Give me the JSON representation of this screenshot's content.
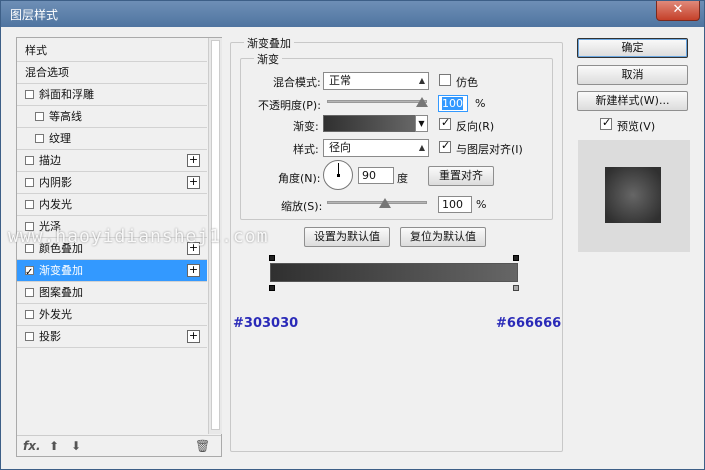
{
  "window": {
    "title": "图层样式",
    "close_glyph": "✕"
  },
  "left_panel": {
    "items": [
      {
        "label": "样式",
        "checkbox": false,
        "checked": false,
        "plus": false,
        "indent": 0,
        "selected": false
      },
      {
        "label": "混合选项",
        "checkbox": false,
        "checked": false,
        "plus": false,
        "indent": 0,
        "selected": false
      },
      {
        "label": "斜面和浮雕",
        "checkbox": true,
        "checked": false,
        "plus": false,
        "indent": 0,
        "selected": false
      },
      {
        "label": "等高线",
        "checkbox": true,
        "checked": false,
        "plus": false,
        "indent": 1,
        "selected": false
      },
      {
        "label": "纹理",
        "checkbox": true,
        "checked": false,
        "plus": false,
        "indent": 1,
        "selected": false
      },
      {
        "label": "描边",
        "checkbox": true,
        "checked": false,
        "plus": true,
        "indent": 0,
        "selected": false
      },
      {
        "label": "内阴影",
        "checkbox": true,
        "checked": false,
        "plus": true,
        "indent": 0,
        "selected": false
      },
      {
        "label": "内发光",
        "checkbox": true,
        "checked": false,
        "plus": false,
        "indent": 0,
        "selected": false
      },
      {
        "label": "光泽",
        "checkbox": true,
        "checked": false,
        "plus": false,
        "indent": 0,
        "selected": false
      },
      {
        "label": "颜色叠加",
        "checkbox": true,
        "checked": false,
        "plus": true,
        "indent": 0,
        "selected": false
      },
      {
        "label": "渐变叠加",
        "checkbox": true,
        "checked": true,
        "plus": true,
        "indent": 0,
        "selected": true
      },
      {
        "label": "图案叠加",
        "checkbox": true,
        "checked": false,
        "plus": false,
        "indent": 0,
        "selected": false
      },
      {
        "label": "外发光",
        "checkbox": true,
        "checked": false,
        "plus": false,
        "indent": 0,
        "selected": false
      },
      {
        "label": "投影",
        "checkbox": true,
        "checked": false,
        "plus": true,
        "indent": 0,
        "selected": false
      }
    ],
    "footer": {
      "fx": "fx.",
      "up": "⬆",
      "down": "⬇",
      "trash": "🗑"
    }
  },
  "gradient_overlay": {
    "group_title": "渐变叠加",
    "sub_title": "渐变",
    "blend_mode_label": "混合模式:",
    "blend_mode_value": "正常",
    "dither_label": "仿色",
    "dither_checked": false,
    "opacity_label": "不透明度(P):",
    "opacity_value": "100",
    "opacity_unit": "%",
    "gradient_label": "渐变:",
    "reverse_label": "反向(R)",
    "reverse_checked": true,
    "style_label": "样式:",
    "style_value": "径向",
    "align_label": "与图层对齐(I)",
    "align_checked": true,
    "angle_label": "角度(N):",
    "angle_value": "90",
    "angle_unit": "度",
    "reset_align_button": "重置对齐",
    "scale_label": "缩放(S):",
    "scale_value": "100",
    "scale_unit": "%",
    "make_default_button": "设置为默认值",
    "reset_default_button": "复位为默认值"
  },
  "gradient_bar": {
    "start_color": "#303030",
    "end_color": "#666666"
  },
  "right_panel": {
    "ok_button": "确定",
    "cancel_button": "取消",
    "new_style_button": "新建样式(W)...",
    "preview_label": "预览(V)",
    "preview_checked": true
  },
  "watermark": "www.haoyidianshej1.com",
  "colors": {
    "accent": "#3399ff",
    "hex_text": "#2a2ab8"
  }
}
